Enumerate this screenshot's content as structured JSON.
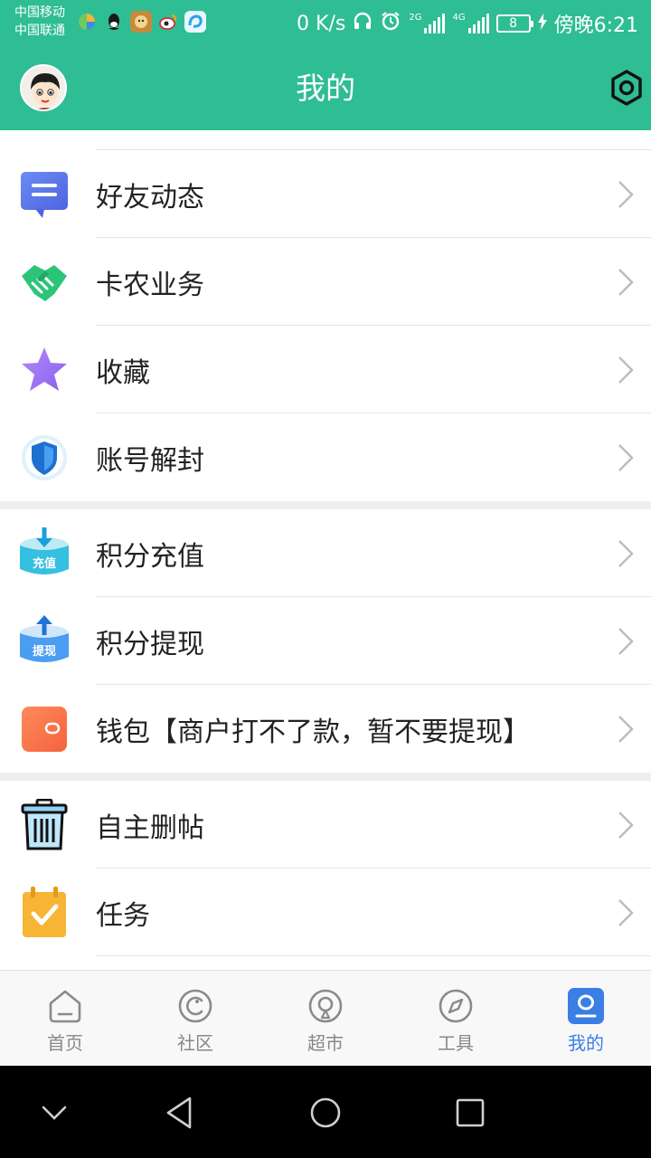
{
  "status_bar": {
    "carrier_1": "中国移动",
    "carrier_2": "中国联通",
    "net_speed": "0 K/s",
    "sig_1": "2G",
    "sig_2": "4G",
    "battery": "8",
    "time": "傍晚6:21"
  },
  "header": {
    "title": "我的",
    "bg_color": "#2fbd93"
  },
  "menu": {
    "group1": [
      {
        "label": "好友动态",
        "icon": "chat-bubble-icon"
      },
      {
        "label": "卡农业务",
        "icon": "handshake-icon"
      },
      {
        "label": "收藏",
        "icon": "star-icon"
      },
      {
        "label": "账号解封",
        "icon": "shield-icon"
      }
    ],
    "group2": [
      {
        "label": "积分充值",
        "icon": "recharge-icon",
        "badge": "充值"
      },
      {
        "label": "积分提现",
        "icon": "withdraw-icon",
        "badge": "提现"
      },
      {
        "label": "钱包【商户打不了款，暂不要提现】",
        "icon": "wallet-icon"
      }
    ],
    "group3": [
      {
        "label": "自主删帖",
        "icon": "trash-icon"
      },
      {
        "label": "任务",
        "icon": "task-calendar-icon"
      }
    ]
  },
  "tabs": [
    {
      "label": "首页",
      "icon": "home-icon"
    },
    {
      "label": "社区",
      "icon": "community-icon"
    },
    {
      "label": "超市",
      "icon": "market-icon"
    },
    {
      "label": "工具",
      "icon": "compass-icon"
    },
    {
      "label": "我的",
      "icon": "profile-icon",
      "active": true
    }
  ],
  "colors": {
    "accent": "#2fbd93",
    "active_tab": "#3a7ee6"
  }
}
